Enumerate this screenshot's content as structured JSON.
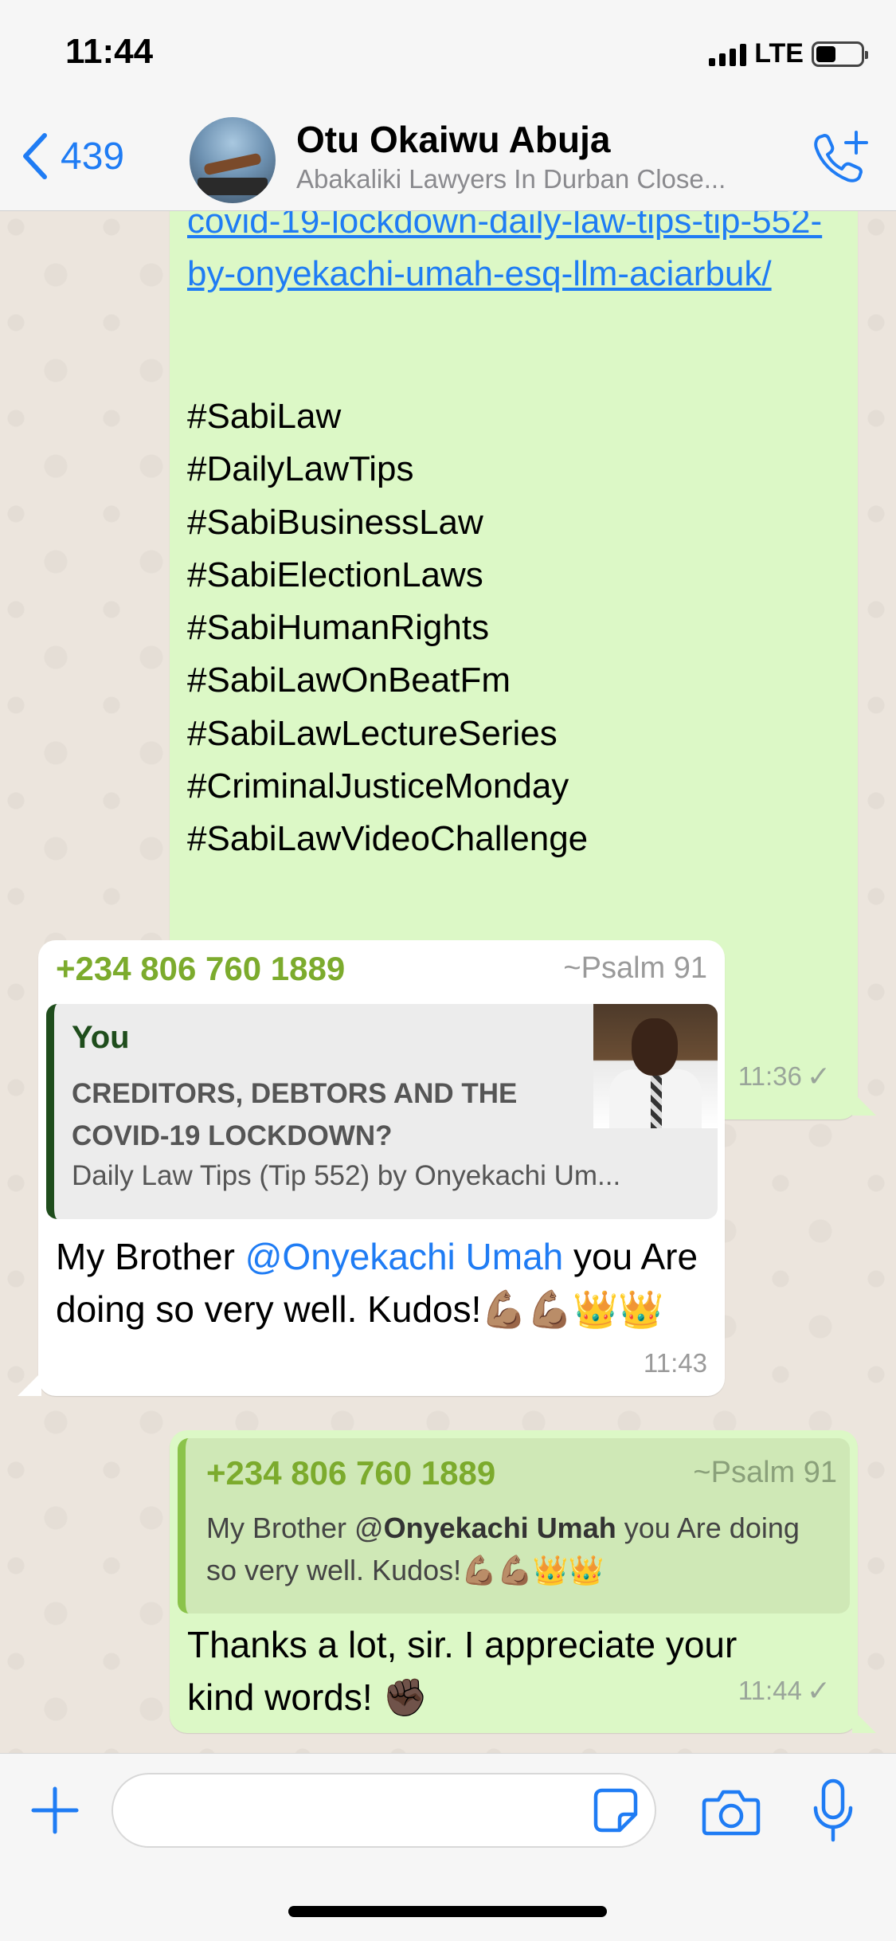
{
  "status_bar": {
    "time": "11:44",
    "network": "LTE"
  },
  "header": {
    "back_count": "439",
    "contact_name": "Otu Okaiwu Abuja",
    "subtitle": "Abakaliki Lawyers In Durban Close..."
  },
  "messages": [
    {
      "direction": "outgoing",
      "link_text": "covid-19-lockdown-daily-law-tips-tip-552-by-onyekachi-umah-esq-llm-aciarbuk/",
      "hashtags": [
        "#SabiLaw",
        "#DailyLawTips",
        "#SabiBusinessLaw",
        "#SabiElectionLaws",
        "#SabiHumanRights",
        "#SabiLawOnBeatFm",
        "#SabiLawLectureSeries",
        "#CriminalJusticeMonday",
        "#SabiLawVideoChallenge"
      ],
      "time": "11:36",
      "status": "✓"
    },
    {
      "direction": "incoming",
      "sender": "+234 806 760 1889",
      "push_name": "~Psalm 91",
      "quoted": {
        "author": "You",
        "title": "CREDITORS, DEBTORS AND THE COVID-19 LOCKDOWN?",
        "description": "Daily Law Tips (Tip 552) by Onyekachi Um..."
      },
      "text_before": "My Brother ",
      "mention": "@Onyekachi Umah",
      "text_after": " you Are doing so very well. Kudos!💪🏽💪🏽👑👑",
      "time": "11:43"
    },
    {
      "direction": "outgoing",
      "quoted": {
        "sender": "+234 806 760 1889",
        "push_name": "~Psalm 91",
        "text_before": "My Brother @",
        "mention": "Onyekachi Umah",
        "text_after": " you Are doing so very well. Kudos!💪🏽💪🏽👑👑"
      },
      "text": "Thanks a lot, sir. I appreciate your kind words! ✊🏿",
      "time": "11:44",
      "status": "✓"
    }
  ],
  "colors": {
    "accent": "#1f7cf4",
    "outgoing_bubble": "#dcf8c6",
    "incoming_bubble": "#ffffff",
    "sender_name": "#7cab2d",
    "chat_background": "#ece5dd"
  },
  "icons": {
    "back": "chevron-left-icon",
    "call": "add-call-icon",
    "plus": "plus-icon",
    "sticker": "sticker-icon",
    "camera": "camera-icon",
    "mic": "microphone-icon"
  }
}
